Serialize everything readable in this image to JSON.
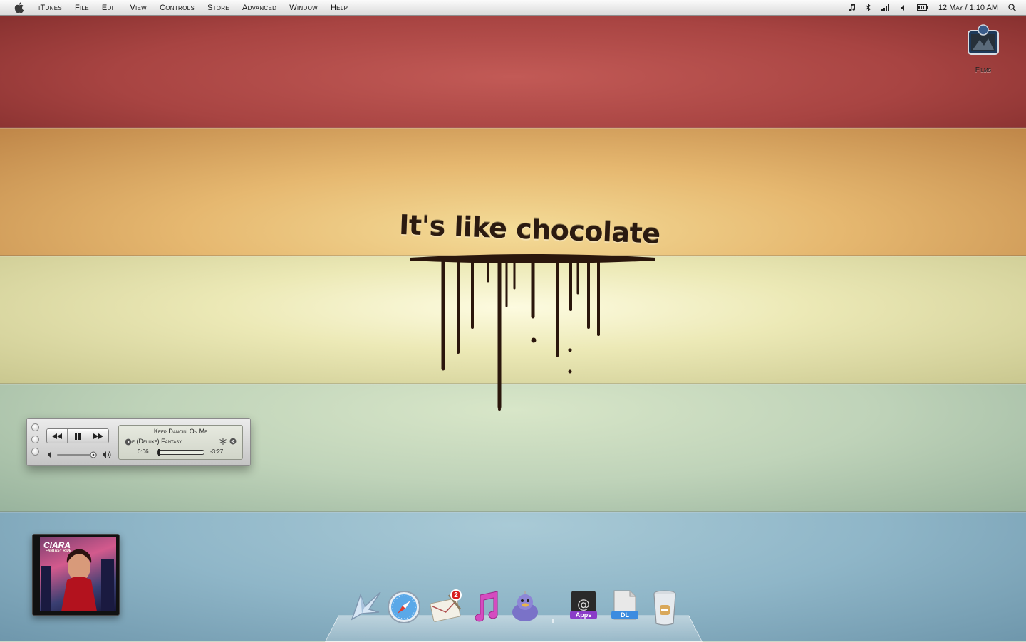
{
  "menubar": {
    "app_name": "iTunes",
    "items": [
      "File",
      "Edit",
      "View",
      "Controls",
      "Store",
      "Advanced",
      "Window",
      "Help"
    ],
    "clock": "12 May / 1:10 AM"
  },
  "desktop": {
    "icons": [
      {
        "label": "Films"
      }
    ]
  },
  "wallpaper": {
    "text": "It's like chocolate"
  },
  "mini_player": {
    "track_title": "Keep Dancin' On Me",
    "track_subtitle": "e (Deluxe)   Fantasy",
    "elapsed": "0:06",
    "remaining": "-3:27",
    "progress_fraction": 0.03
  },
  "album_art": {
    "artist": "CIARA",
    "album": "FANTASY RIDE"
  },
  "dock": {
    "mail_badge": "2",
    "apps_stack_label": "Apps",
    "dl_stack_label": "DL"
  },
  "colors": {
    "stripe_red": "#b14d4a",
    "stripe_orange": "#e6b870",
    "stripe_yellow": "#ece9b6",
    "stripe_green": "#bfd3b9",
    "stripe_blue": "#8fb6c8",
    "badge_red": "#d71e1e"
  }
}
